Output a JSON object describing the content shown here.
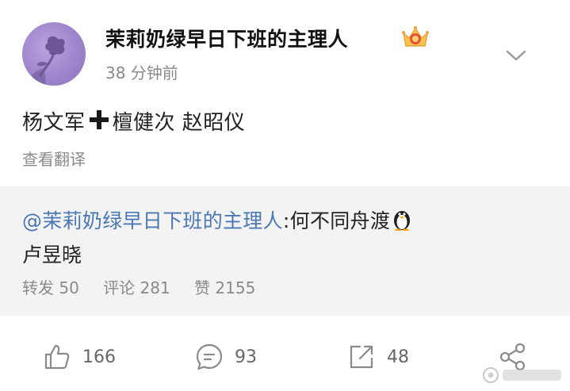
{
  "post": {
    "username": "茉莉奶绿早日下班的主理人",
    "timestamp": "38 分钟前",
    "text_before": "杨文军",
    "text_after": "檀健次 赵昭仪",
    "translate_label": "查看翻译"
  },
  "repost": {
    "mention": "@茉莉奶绿早日下班的主理人",
    "colon": ":",
    "text": "何不同舟渡",
    "line2": "卢昱晓",
    "stats": {
      "forward": "转发 50",
      "comment": "评论 281",
      "like": "赞 2155"
    }
  },
  "actions": {
    "like_count": "166",
    "comment_count": "93",
    "repost_count": "48"
  },
  "icons": {
    "vip": "vip-crown-icon",
    "more": "chevron-down-icon",
    "like": "thumbs-up-icon",
    "comment": "comment-bubble-icon",
    "repost": "repost-arrow-icon",
    "share": "share-nodes-icon",
    "penguin": "penguin-emoji-icon",
    "plus": "heavy-plus-emoji-icon"
  },
  "colors": {
    "link": "#4a78b3",
    "secondary_text": "#8a8a8a",
    "repost_bg": "#f3f3f3",
    "vip_gold": "#e8a33a"
  }
}
